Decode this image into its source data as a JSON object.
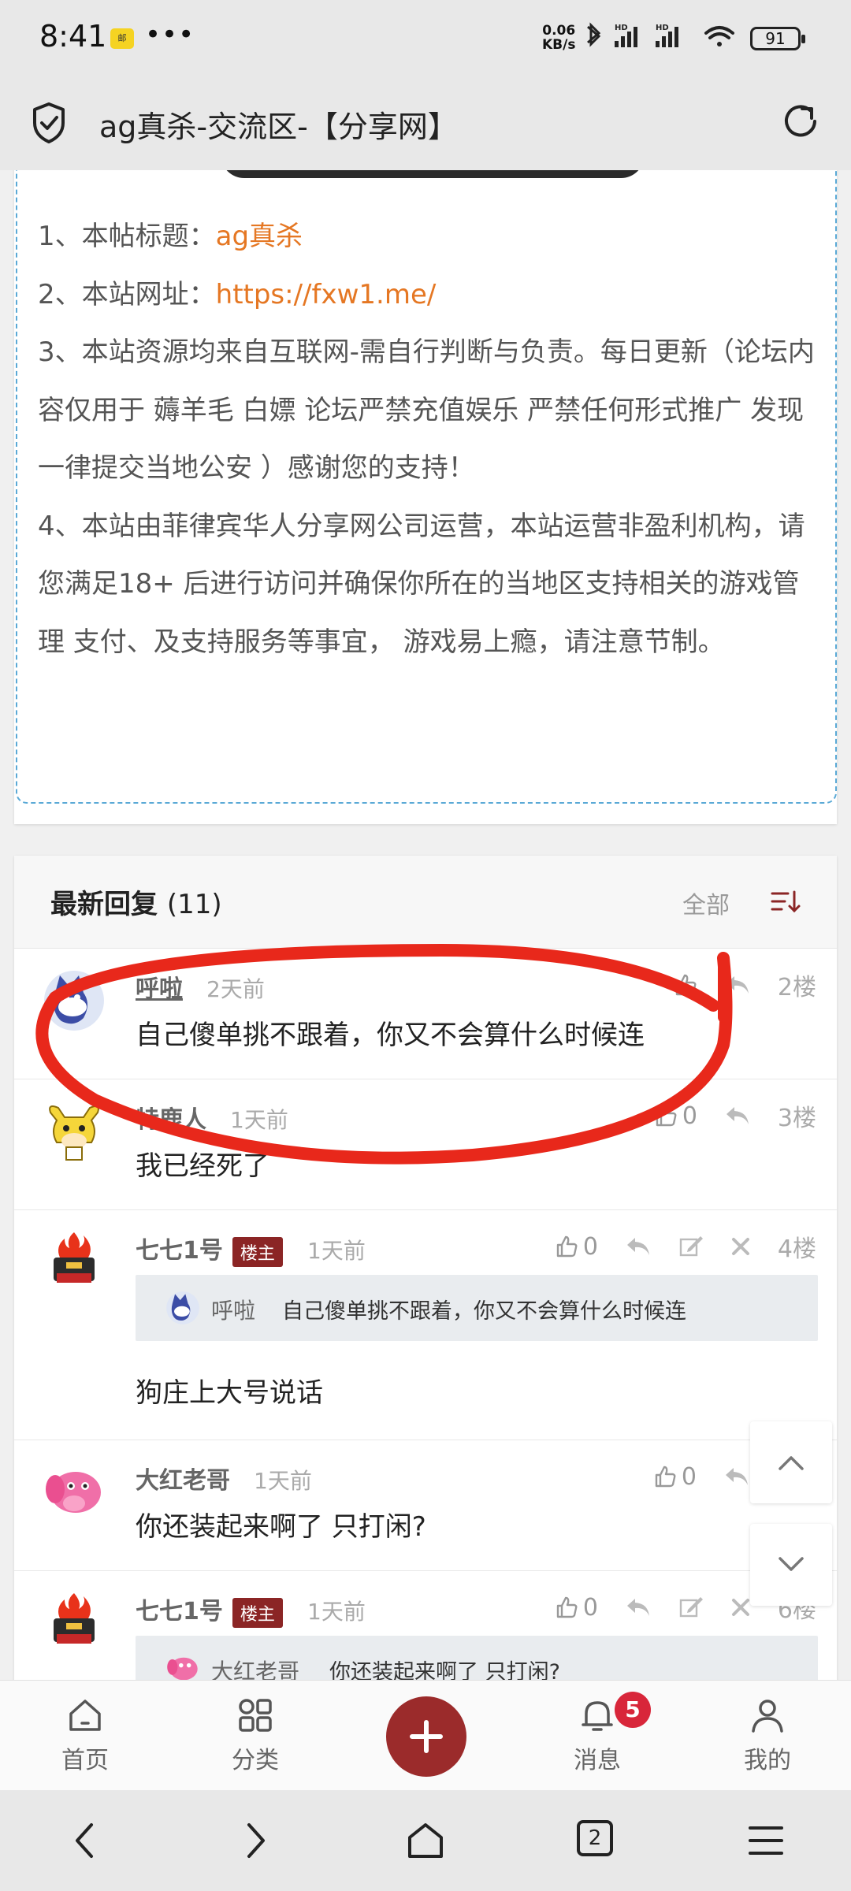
{
  "status_bar": {
    "time": "8:41",
    "app_badge": "邮",
    "more": "•••",
    "net_speed_value": "0.06",
    "net_speed_unit": "KB/s",
    "battery": "91"
  },
  "browser": {
    "title": "ag真杀-交流区-【分享网】"
  },
  "notice": {
    "line1_label": "1、本帖标题：",
    "line1_value": "ag真杀",
    "line2_label": "2、本站网址：",
    "line2_value": "https://fxw1.me/",
    "line3": "3、本站资源均来自互联网-需自行判断与负责。每日更新（论坛内容仅用于 薅羊毛 白嫖 论坛严禁充值娱乐 严禁任何形式推广 发现一律提交当地公安 ）感谢您的支持！",
    "line4": "4、本站由菲律宾华人分享网公司运营，本站运营非盈利机构，请您满足18+ 后进行访问并确保你所在的当地区支持相关的游戏管理 支付、及支持服务等事宜， 游戏易上瘾，请注意节制。"
  },
  "replies": {
    "title": "最新回复",
    "count": "(11)",
    "all_label": "全部",
    "items": [
      {
        "name": "呼啦",
        "time": "2天前",
        "text": "自己傻单挑不跟着，你又不会算什么时候连",
        "likes": "",
        "floor": "2楼"
      },
      {
        "name": "特鹿人",
        "time": "1天前",
        "text": "我已经死了",
        "likes": "0",
        "floor": "3楼"
      },
      {
        "name": "七七1号",
        "badge": "楼主",
        "time": "1天前",
        "quote_name": "呼啦",
        "quote_text": "自己傻单挑不跟着，你又不会算什么时候连",
        "text": "狗庄上大号说话",
        "likes": "0",
        "floor": "4楼"
      },
      {
        "name": "大红老哥",
        "time": "1天前",
        "text": "你还装起来啊了  只打闲?",
        "likes": "0",
        "floor": ""
      },
      {
        "name": "七七1号",
        "badge": "楼主",
        "time": "1天前",
        "quote_name": "大红老哥",
        "quote_text": "你还装起来啊了 只打闲?",
        "likes": "0",
        "floor": "6楼"
      }
    ]
  },
  "bottom_nav": {
    "home": "首页",
    "category": "分类",
    "messages": "消息",
    "messages_badge": "5",
    "mine": "我的"
  },
  "system_nav": {
    "tabs_count": "2"
  },
  "colors": {
    "accent": "#9b2b2b",
    "link_orange": "#e57723",
    "annotation_red": "#e8281b"
  }
}
